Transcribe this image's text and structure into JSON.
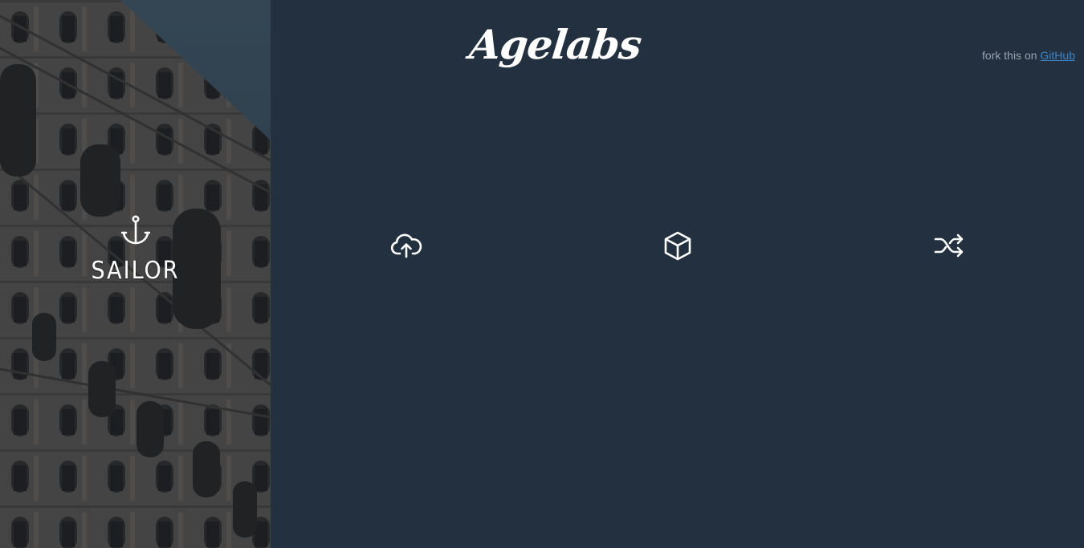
{
  "hero": {
    "title": "SAILOR",
    "icon": "anchor-icon"
  },
  "header": {
    "logo": "Agelabs",
    "fork_prefix": "fork this on",
    "fork_link": "GitHub"
  },
  "features": [
    {
      "icon": "cloud-upload-icon"
    },
    {
      "icon": "cube-icon"
    },
    {
      "icon": "shuffle-icon"
    }
  ],
  "colors": {
    "background": "#22303f",
    "link": "#3f86c6",
    "muted_text": "#9aa3ad",
    "text": "#ffffff"
  }
}
